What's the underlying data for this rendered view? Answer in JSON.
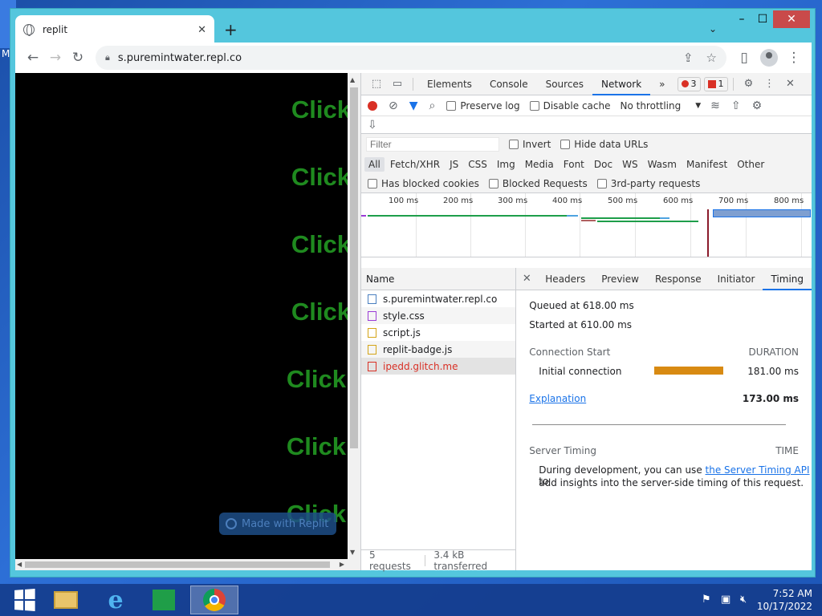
{
  "desktop": {
    "left_text": "M"
  },
  "window": {
    "minimize": "–",
    "maximize": "☐",
    "close": "✕"
  },
  "browser": {
    "tab_title": "replit",
    "tab_close": "✕",
    "new_tab": "+",
    "tab_menu": "⌄",
    "url": "s.puremintwater.repl.co"
  },
  "page": {
    "click_texts": [
      "Click",
      "Click",
      "Click",
      "Click",
      "Click",
      "Click",
      "Click"
    ],
    "badge": "Made with Replit"
  },
  "devtools": {
    "tabs": [
      "Elements",
      "Console",
      "Sources",
      "Network"
    ],
    "active_tab": "Network",
    "more": "»",
    "error_count": "3",
    "issue_count": "1",
    "toolbar": {
      "preserve_log": "Preserve log",
      "disable_cache": "Disable cache",
      "throttling": "No throttling"
    },
    "filter": {
      "placeholder": "Filter",
      "invert": "Invert",
      "hide_data_urls": "Hide data URLs"
    },
    "types": [
      "All",
      "Fetch/XHR",
      "JS",
      "CSS",
      "Img",
      "Media",
      "Font",
      "Doc",
      "WS",
      "Wasm",
      "Manifest",
      "Other"
    ],
    "blocked": {
      "has_blocked_cookies": "Has blocked cookies",
      "blocked_requests": "Blocked Requests",
      "third_party": "3rd-party requests"
    },
    "timeline_ticks": [
      "100 ms",
      "200 ms",
      "300 ms",
      "400 ms",
      "500 ms",
      "600 ms",
      "700 ms",
      "800 ms"
    ],
    "name_header": "Name",
    "requests": [
      {
        "name": "s.puremintwater.repl.co",
        "type": "doc"
      },
      {
        "name": "style.css",
        "type": "css"
      },
      {
        "name": "script.js",
        "type": "js"
      },
      {
        "name": "replit-badge.js",
        "type": "js"
      },
      {
        "name": "ipedd.glitch.me",
        "type": "error"
      }
    ],
    "status": {
      "requests": "5 requests",
      "transferred": "3.4 kB transferred"
    },
    "detail_tabs": [
      "Headers",
      "Preview",
      "Response",
      "Initiator",
      "Timing"
    ],
    "detail_active": "Timing",
    "timing": {
      "queued": "Queued at 618.00 ms",
      "started": "Started at 610.00 ms",
      "connection_start": "Connection Start",
      "duration_label": "DURATION",
      "initial_connection": "Initial connection",
      "initial_duration": "181.00 ms",
      "explanation": "Explanation",
      "total": "173.00 ms",
      "server_timing": "Server Timing",
      "time_label": "TIME",
      "server_text_1": "During development, you can use ",
      "server_link": "the Server Timing API",
      "server_text_2": " to",
      "server_text_3": "add insights into the server-side timing of this request."
    }
  },
  "taskbar": {
    "time": "7:52 AM",
    "date": "10/17/2022"
  },
  "colors": {
    "click_green": "#1f8a1f",
    "accent": "#1a73e8",
    "error": "#d93025",
    "window_frame": "#54c6dd"
  }
}
